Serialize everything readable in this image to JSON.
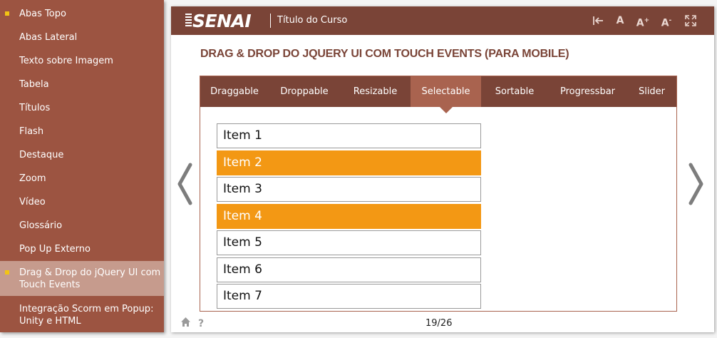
{
  "sidebar": {
    "items": [
      {
        "label": "Abas Topo",
        "bullet": true,
        "active": false
      },
      {
        "label": "Abas Lateral",
        "bullet": false,
        "active": false
      },
      {
        "label": "Texto sobre Imagem",
        "bullet": false,
        "active": false
      },
      {
        "label": "Tabela",
        "bullet": false,
        "active": false
      },
      {
        "label": "Títulos",
        "bullet": false,
        "active": false
      },
      {
        "label": "Flash",
        "bullet": false,
        "active": false
      },
      {
        "label": "Destaque",
        "bullet": false,
        "active": false
      },
      {
        "label": "Zoom",
        "bullet": false,
        "active": false
      },
      {
        "label": "Vídeo",
        "bullet": false,
        "active": false
      },
      {
        "label": "Glossário",
        "bullet": false,
        "active": false
      },
      {
        "label": "Pop Up Externo",
        "bullet": false,
        "active": false
      },
      {
        "label": "Drag & Drop do jQuery UI com Touch Events",
        "bullet": true,
        "active": true
      },
      {
        "label": "Integração Scorm em Popup: Unity e HTML",
        "bullet": false,
        "active": false
      }
    ]
  },
  "header": {
    "logo": "SENAI",
    "course_title": "Título do Curso",
    "buttons": {
      "back_icon": "first-page-icon",
      "font_default_label": "A",
      "font_increase_label": "A",
      "font_increase_sup": "+",
      "font_decrease_label": "A",
      "font_decrease_sup": "-",
      "fullscreen_icon": "fullscreen-icon"
    }
  },
  "page": {
    "heading": "DRAG & DROP DO JQUERY UI COM TOUCH EVENTS (PARA MOBILE)"
  },
  "tabs": [
    {
      "label": "Draggable",
      "active": false
    },
    {
      "label": "Droppable",
      "active": false
    },
    {
      "label": "Resizable",
      "active": false
    },
    {
      "label": "Selectable",
      "active": true
    },
    {
      "label": "Sortable",
      "active": false
    },
    {
      "label": "Progressbar",
      "active": false
    },
    {
      "label": "Slider",
      "active": false
    }
  ],
  "selectable": {
    "items": [
      {
        "label": "Item 1",
        "selected": false
      },
      {
        "label": "Item 2",
        "selected": true
      },
      {
        "label": "Item 3",
        "selected": false
      },
      {
        "label": "Item 4",
        "selected": true
      },
      {
        "label": "Item 5",
        "selected": false
      },
      {
        "label": "Item 6",
        "selected": false
      },
      {
        "label": "Item 7",
        "selected": false
      }
    ]
  },
  "footer": {
    "home_icon": "home-icon",
    "help_label": "?",
    "pager": "19/26"
  },
  "colors": {
    "header": "#7a4437",
    "sidebar": "#9c5441",
    "sidebar_active": "#c69b8d",
    "tab_active": "#a9634f",
    "selected": "#f39814",
    "bullet": "#f2c414"
  }
}
